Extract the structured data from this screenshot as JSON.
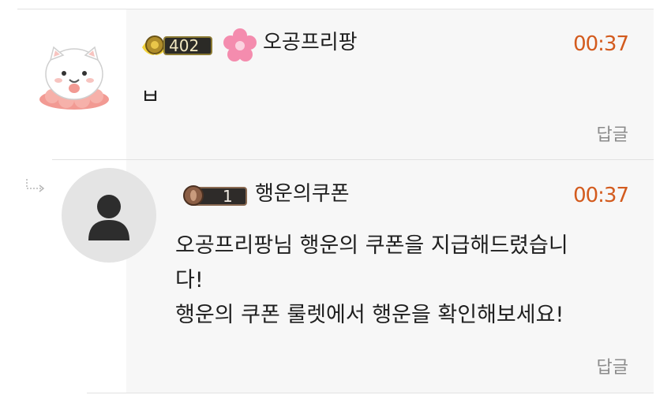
{
  "comments": [
    {
      "level": "402",
      "username": "오공프리팡",
      "time": "00:37",
      "text": "ㅂ",
      "reply_label": "답글",
      "avatar": "white-cat-sticker",
      "badge_icon": "gold-level-badge-icon",
      "extra_icon": "pink-flower-icon"
    },
    {
      "level": "1",
      "username": "행운의쿠폰",
      "time": "00:37",
      "text": "오공프리팡님 행운의 쿠폰을 지급해드렸습니\n다!\n행운의 쿠폰 룰렛에서 행운을 확인해보세요!",
      "reply_label": "답글",
      "avatar": "default-user-icon",
      "badge_icon": "bronze-level-badge-icon",
      "is_reply": true
    }
  ],
  "colors": {
    "time": "#d35b1e",
    "reply": "#8b8b8b",
    "divider": "#e2e2e2",
    "background_shade": "#f7f7f7"
  }
}
